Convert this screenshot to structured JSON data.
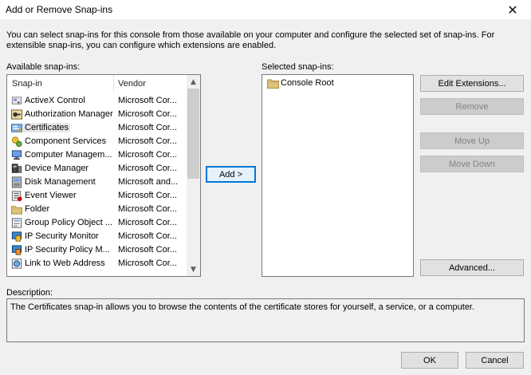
{
  "window": {
    "title": "Add or Remove Snap-ins",
    "close_glyph": "✕"
  },
  "intro": {
    "text": "You can select snap-ins for this console from those available on your computer and configure the selected set of snap-ins. For extensible snap-ins, you can configure which extensions are enabled."
  },
  "available": {
    "label": "Available snap-ins:",
    "columns": {
      "snapin": "Snap-in",
      "vendor": "Vendor"
    },
    "items": [
      {
        "name": "ActiveX Control",
        "vendor": "Microsoft Cor...",
        "icon": "activex-icon",
        "selected": false
      },
      {
        "name": "Authorization Manager",
        "vendor": "Microsoft Cor...",
        "icon": "authorization-icon",
        "selected": false
      },
      {
        "name": "Certificates",
        "vendor": "Microsoft Cor...",
        "icon": "certificates-icon",
        "selected": true
      },
      {
        "name": "Component Services",
        "vendor": "Microsoft Cor...",
        "icon": "component-services-icon",
        "selected": false
      },
      {
        "name": "Computer Managem...",
        "vendor": "Microsoft Cor...",
        "icon": "computer-management-icon",
        "selected": false
      },
      {
        "name": "Device Manager",
        "vendor": "Microsoft Cor...",
        "icon": "device-manager-icon",
        "selected": false
      },
      {
        "name": "Disk Management",
        "vendor": "Microsoft and...",
        "icon": "disk-management-icon",
        "selected": false
      },
      {
        "name": "Event Viewer",
        "vendor": "Microsoft Cor...",
        "icon": "event-viewer-icon",
        "selected": false
      },
      {
        "name": "Folder",
        "vendor": "Microsoft Cor...",
        "icon": "folder-icon",
        "selected": false
      },
      {
        "name": "Group Policy Object ...",
        "vendor": "Microsoft Cor...",
        "icon": "group-policy-icon",
        "selected": false
      },
      {
        "name": "IP Security Monitor",
        "vendor": "Microsoft Cor...",
        "icon": "ip-security-monitor-icon",
        "selected": false
      },
      {
        "name": "IP Security Policy M...",
        "vendor": "Microsoft Cor...",
        "icon": "ip-security-policy-icon",
        "selected": false
      },
      {
        "name": "Link to Web Address",
        "vendor": "Microsoft Cor...",
        "icon": "link-icon",
        "selected": false
      }
    ],
    "scroll_up": "▲",
    "scroll_down": "▼"
  },
  "add_button": {
    "label": "Add >"
  },
  "selected": {
    "label": "Selected snap-ins:",
    "items": [
      {
        "name": "Console Root",
        "icon": "folder-icon"
      }
    ]
  },
  "side_buttons": {
    "edit_extensions": "Edit Extensions...",
    "remove": "Remove",
    "move_up": "Move Up",
    "move_down": "Move Down",
    "advanced": "Advanced..."
  },
  "description": {
    "label": "Description:",
    "text": "The Certificates snap-in allows you to browse the contents of the certificate stores for yourself, a service, or a computer."
  },
  "footer": {
    "ok": "OK",
    "cancel": "Cancel"
  },
  "colors": {
    "default_button_border": "#0078d7",
    "folder": "#dcc27a"
  }
}
